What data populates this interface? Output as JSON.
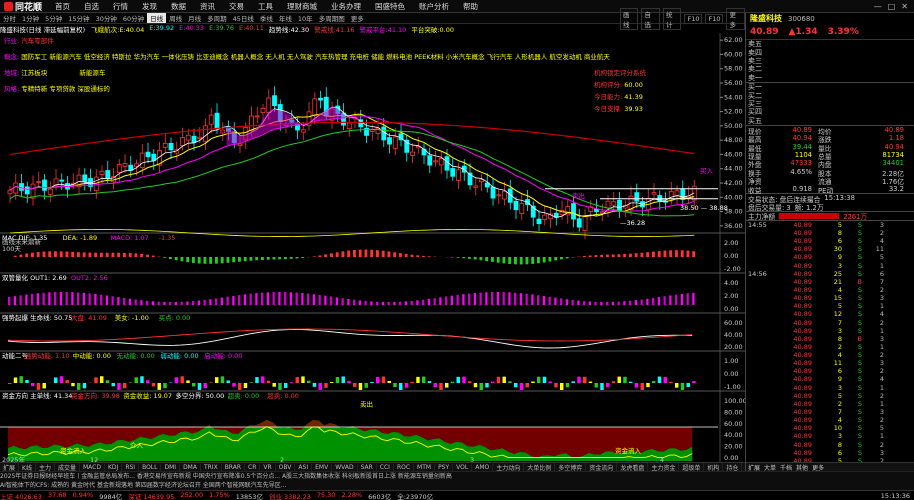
{
  "menubar": {
    "app_name": "同花顺",
    "items": [
      "首页",
      "自选",
      "行情",
      "发现",
      "数据",
      "资讯",
      "交易",
      "工具",
      "理财商城",
      "业务办理",
      "国盛特色",
      "账户分析",
      "帮助"
    ]
  },
  "periods": [
    "分时",
    "1分钟",
    "5分钟",
    "15分钟",
    "30分钟",
    "60分钟",
    "日线",
    "周线",
    "月线",
    "多周期",
    "45日线",
    "季线",
    "年线",
    "10年",
    "多周期图",
    "更多"
  ],
  "active_period": "日线",
  "right_tools": [
    "画线",
    "自选",
    "统计",
    "F10",
    "F10",
    "更多"
  ],
  "info_bar": {
    "title": "隆盛科技(日线 滞延幅前复权)",
    "items": [
      {
        "label": "飞蛾航次:",
        "value": "E:40.04",
        "color": "#ff0"
      },
      {
        "label": "",
        "value": "E:39.92",
        "color": "#0ff"
      },
      {
        "label": "",
        "value": "E:40.33",
        "color": "#f0f"
      },
      {
        "label": "",
        "value": "E:39.76",
        "color": "#2c2"
      },
      {
        "label": "",
        "value": "E:40.11",
        "color": "#f33"
      },
      {
        "label": "趋势线:",
        "value": "42.30",
        "color": "#fff"
      },
      {
        "label": "警戒线:",
        "value": "41.16",
        "color": "#f33"
      },
      {
        "label": "警戒平台:",
        "value": "41.10",
        "color": "#f0f"
      },
      {
        "label": "平台突破:",
        "value": "0.00",
        "color": "#ff0"
      }
    ]
  },
  "concepts": {
    "industry_label": "行业:",
    "industry": "汽车零部件",
    "concepts_label": "概念:",
    "concepts": "国防军工 新能源汽车 低空经济 特斯拉 华为汽车 一体化压铸 比亚迪概念 机器人概念 无人机 无人驾驶 汽车热管理 充电桩 储能 燃料电池 PEEK材料 小米汽车概念 飞行汽车 人形机器人 航空发动机 商业航天",
    "region_label": "地域:",
    "region": "江苏板块",
    "region_extra": "新能源车",
    "style_label": "风格:",
    "style": "专精特新 专项贷款 深股通标的"
  },
  "inst_box": {
    "title": "机构锁定评分系统",
    "lines": [
      {
        "label": "机构评分:",
        "value": "60.00"
      },
      {
        "label": "今日能力:",
        "value": "41.39"
      },
      {
        "label": "今日支撑:",
        "value": "39.93"
      }
    ]
  },
  "price_axis": [
    "62.00",
    "60.00",
    "58.00",
    "56.00",
    "54.00",
    "52.00",
    "50.00",
    "48.00",
    "46.00",
    "44.00",
    "42.00",
    "40.00",
    "38.00",
    "36.00"
  ],
  "chart_annotations": {
    "low1": "36.28",
    "low2": "38.50",
    "low3": "38.88",
    "buy_mark": "买入",
    "sell_mark": "卖出"
  },
  "volume_panel": {
    "label": "画线未来鼎新",
    "sub": "100天"
  },
  "panels": {
    "macd": {
      "name": "MACD",
      "labels": [
        {
          "t": "MAC DIF: 1.35",
          "c": "#fff"
        },
        {
          "t": "DEA: -1.89",
          "c": "#ff0"
        },
        {
          "t": "MACD: 1.07",
          "c": "#f0f"
        },
        {
          "t": "-1.35",
          "c": "#f33"
        }
      ],
      "axis": [
        "2.00",
        "0.00",
        "-2.00"
      ]
    },
    "dual": {
      "name": "双管量化",
      "labels": [
        {
          "t": "双管量化 OUT1: 2.69",
          "c": "#fff"
        },
        {
          "t": "OUT2: 2.56",
          "c": "#f0f"
        }
      ],
      "axis": [
        "4.00",
        "2.00",
        "0.00"
      ]
    },
    "trend": {
      "name": "强势起爆",
      "labels": [
        {
          "t": "强势起爆 生命线: 50.75",
          "c": "#fff"
        },
        {
          "t": "大盘: 41.09",
          "c": "#f33"
        },
        {
          "t": "美女: -1.00",
          "c": "#ff0"
        },
        {
          "t": "买点: 0.00",
          "c": "#2c2"
        }
      ],
      "axis": [
        "60.00",
        "40.00",
        "20.00"
      ]
    },
    "momentum": {
      "name": "动能二号",
      "labels": [
        {
          "t": "动能二号",
          "c": "#fff"
        },
        {
          "t": "强势动能: 1.10",
          "c": "#f33"
        },
        {
          "t": "中动能: 0.00",
          "c": "#ff0"
        },
        {
          "t": "无动能: 0.00",
          "c": "#2c2"
        },
        {
          "t": "弱动能: 0.00",
          "c": "#0ff"
        },
        {
          "t": "启动能: 0.00",
          "c": "#f0f"
        }
      ],
      "axis": [
        "1.00",
        "0.00",
        "-1.00"
      ]
    },
    "fund": {
      "name": "资金方向",
      "labels": [
        {
          "t": "资金方向 主单线: 41.34",
          "c": "#fff"
        },
        {
          "t": "资金方向: 39.98",
          "c": "#f33"
        },
        {
          "t": "资金收益: 19.07",
          "c": "#ff0"
        },
        {
          "t": "多空分界: 50.00",
          "c": "#fff"
        },
        {
          "t": "超卖: 0.00",
          "c": "#2c2"
        },
        {
          "t": "超卖: 0.00",
          "c": "#f33"
        }
      ],
      "axis": [
        "100.00",
        "80.00",
        "60.00",
        "40.00",
        "20.00",
        "0.00"
      ],
      "tags": [
        "资金流入",
        "资金流入",
        "介入",
        "卖出"
      ]
    }
  },
  "x_axis": {
    "year": "2025年",
    "labels": [
      "12",
      "2",
      "3",
      "4"
    ]
  },
  "bottom_tabs": [
    "扩展",
    "K线",
    "主力",
    "成交量",
    "MACD",
    "KDJ",
    "RSI",
    "BOLL",
    "DMI",
    "DMA",
    "TRIX",
    "BRAR",
    "CR",
    "VR",
    "OBV",
    "ASI",
    "EMV",
    "WVAD",
    "SAR",
    "CCI",
    "ROC",
    "MTM",
    "PSY",
    "VOL",
    "AMO",
    "主力动向",
    "大单比例",
    "多空博弈",
    "资金流向",
    "龙虎看盘",
    "主力资金",
    "超级单",
    "机构",
    "持仓",
    "筹码",
    "换手",
    "量比",
    "涨停",
    "竞价",
    "分时",
    "九转"
  ],
  "news": [
    "2025年证券日报财经早班车丨金融监管总局发布...  香港交易所宣布新规  中国央行宣布降准0.5个百分点...  A股三大指数集体收涨  科创板新股首日上涨  新能源车销量创新高",
    "AI智能体下的CFS: 成熟的 黄金时代  基金新规落地  第四届数字经济论坛召开  全国两个智能网联汽车先导区..."
  ],
  "status": {
    "items": [
      {
        "label": "上证",
        "value": "4026.63",
        "color": "#f33"
      },
      {
        "label": "",
        "value": "37.68",
        "color": "#f33"
      },
      {
        "label": "",
        "value": "0.94%",
        "color": "#f33"
      },
      {
        "label": "",
        "value": "9984亿",
        "color": "#ccc"
      },
      {
        "label": "深证",
        "value": "14639.95",
        "color": "#f33"
      },
      {
        "label": "",
        "value": "252.00",
        "color": "#f33"
      },
      {
        "label": "",
        "value": "1.75%",
        "color": "#f33"
      },
      {
        "label": "",
        "value": "13853亿",
        "color": "#ccc"
      },
      {
        "label": "创业",
        "value": "3382.23",
        "color": "#f33"
      },
      {
        "label": "",
        "value": "75.30",
        "color": "#f33"
      },
      {
        "label": "",
        "value": "2.28%",
        "color": "#f33"
      },
      {
        "label": "",
        "value": "6603亿",
        "color": "#ccc"
      },
      {
        "label": "",
        "value": "全:23970亿",
        "color": "#ccc"
      }
    ],
    "time": "15:13:36"
  },
  "right_panel": {
    "name": "隆盛科技",
    "code": "300680",
    "price": "40.89",
    "change": "▲1.34",
    "pct": "3.39%",
    "asks": [
      {
        "label": "卖五",
        "price": "",
        "vol": ""
      },
      {
        "label": "卖四",
        "price": "",
        "vol": ""
      },
      {
        "label": "卖三",
        "price": "",
        "vol": ""
      },
      {
        "label": "卖二",
        "price": "",
        "vol": ""
      },
      {
        "label": "卖一",
        "price": "",
        "vol": ""
      }
    ],
    "bids": [
      {
        "label": "买一",
        "price": "",
        "vol": ""
      },
      {
        "label": "买二",
        "price": "",
        "vol": ""
      },
      {
        "label": "买三",
        "price": "",
        "vol": ""
      },
      {
        "label": "买四",
        "price": "",
        "vol": ""
      },
      {
        "label": "买五",
        "price": "",
        "vol": ""
      }
    ],
    "stats": [
      {
        "k": "现价",
        "v": "40.89",
        "vc": "#f33",
        "k2": "均价",
        "v2": "40.89",
        "v2c": "#f33"
      },
      {
        "k": "最高",
        "v": "40.94",
        "vc": "#f33",
        "k2": "涨跌",
        "v2": "1.18",
        "v2c": "#f33"
      },
      {
        "k": "最低",
        "v": "39.44",
        "vc": "#2c2",
        "k2": "量比",
        "v2": "40.94",
        "v2c": "#f33"
      },
      {
        "k": "现量",
        "v": "1104",
        "vc": "#ff0",
        "k2": "总量",
        "v2": "81734",
        "v2c": "#ff0"
      },
      {
        "k": "外盘",
        "v": "47333",
        "vc": "#f33",
        "k2": "内盘",
        "v2": "34401",
        "v2c": "#2c2"
      },
      {
        "k": "换手",
        "v": "4.65%",
        "vc": "#ccc",
        "k2": "股本",
        "v2": "2.28亿",
        "v2c": "#ccc"
      },
      {
        "k": "净资",
        "v": "",
        "vc": "#ccc",
        "k2": "流通",
        "v2": "1.76亿",
        "v2c": "#ccc"
      },
      {
        "k": "收益",
        "v": "0.918",
        "vc": "#ccc",
        "k2": "PE动",
        "v2": "33.2",
        "v2c": "#ccc"
      }
    ],
    "trade_status": "交易状态: 盘后连续撮合",
    "trade_time": "15:13:38",
    "after_volume": "盘后交易量: 3",
    "after_amount": "额: 1.2万",
    "main_flow_label": "主力净额",
    "main_flow_value": "2261万",
    "ticks": [
      {
        "t": "14:55",
        "p": "40.89",
        "n": "5",
        "d": "S",
        "c": "3"
      },
      {
        "t": "",
        "p": "40.89",
        "n": "8",
        "d": "S",
        "c": "2"
      },
      {
        "t": "",
        "p": "40.89",
        "n": "6",
        "d": "S",
        "c": "4"
      },
      {
        "t": "",
        "p": "40.89",
        "n": "30",
        "d": "S",
        "c": "11"
      },
      {
        "t": "",
        "p": "40.89",
        "n": "9",
        "d": "S",
        "c": "5"
      },
      {
        "t": "",
        "p": "40.89",
        "n": "3",
        "d": "S",
        "c": "1"
      },
      {
        "t": "14:56",
        "p": "40.89",
        "n": "25",
        "d": "S",
        "c": "6"
      },
      {
        "t": "",
        "p": "40.89",
        "n": "21",
        "d": "B",
        "c": "7"
      },
      {
        "t": "",
        "p": "40.89",
        "n": "4",
        "d": "S",
        "c": "2"
      },
      {
        "t": "",
        "p": "40.89",
        "n": "15",
        "d": "S",
        "c": "3"
      },
      {
        "t": "",
        "p": "40.89",
        "n": "5",
        "d": "S",
        "c": "1"
      },
      {
        "t": "",
        "p": "40.89",
        "n": "12",
        "d": "S",
        "c": "4"
      },
      {
        "t": "",
        "p": "40.89",
        "n": "7",
        "d": "S",
        "c": "2"
      },
      {
        "t": "",
        "p": "40.89",
        "n": "3",
        "d": "S",
        "c": "1"
      },
      {
        "t": "",
        "p": "40.89",
        "n": "8",
        "d": "B",
        "c": "3"
      },
      {
        "t": "",
        "p": "40.89",
        "n": "2",
        "d": "S",
        "c": "1"
      },
      {
        "t": "",
        "p": "40.89",
        "n": "4",
        "d": "S",
        "c": "2"
      },
      {
        "t": "",
        "p": "40.89",
        "n": "11",
        "d": "S",
        "c": "3"
      },
      {
        "t": "",
        "p": "40.89",
        "n": "6",
        "d": "S",
        "c": "2"
      },
      {
        "t": "",
        "p": "40.89",
        "n": "9",
        "d": "S",
        "c": "4"
      },
      {
        "t": "",
        "p": "40.89",
        "n": "3",
        "d": "S",
        "c": "1"
      },
      {
        "t": "",
        "p": "40.89",
        "n": "5",
        "d": "S",
        "c": "2"
      },
      {
        "t": "",
        "p": "40.89",
        "n": "2",
        "d": "S",
        "c": "1"
      },
      {
        "t": "",
        "p": "40.89",
        "n": "7",
        "d": "S",
        "c": "3"
      },
      {
        "t": "",
        "p": "40.89",
        "n": "4",
        "d": "S",
        "c": "2"
      },
      {
        "t": "",
        "p": "40.89",
        "n": "10",
        "d": "S",
        "c": "5"
      },
      {
        "t": "",
        "p": "40.89",
        "n": "3",
        "d": "S",
        "c": "1"
      },
      {
        "t": "",
        "p": "40.89",
        "n": "8",
        "d": "S",
        "c": "2"
      },
      {
        "t": "",
        "p": "40.89",
        "n": "6",
        "d": "S",
        "c": "3"
      },
      {
        "t": "",
        "p": "40.89",
        "n": "5",
        "d": "S",
        "c": "2"
      },
      {
        "t": "15:00",
        "p": "40.89",
        "n": "12",
        "d": "S",
        "c": "4"
      }
    ],
    "footer_tabs": [
      "扩展",
      "大单",
      "千档",
      "其他",
      "更多"
    ]
  },
  "colors": {
    "up": "#f33",
    "down": "#2c2",
    "ma5": "#fff",
    "ma10": "#ff0",
    "ma20": "#f0f",
    "ma60": "#2c2",
    "ma120": "#c00"
  }
}
